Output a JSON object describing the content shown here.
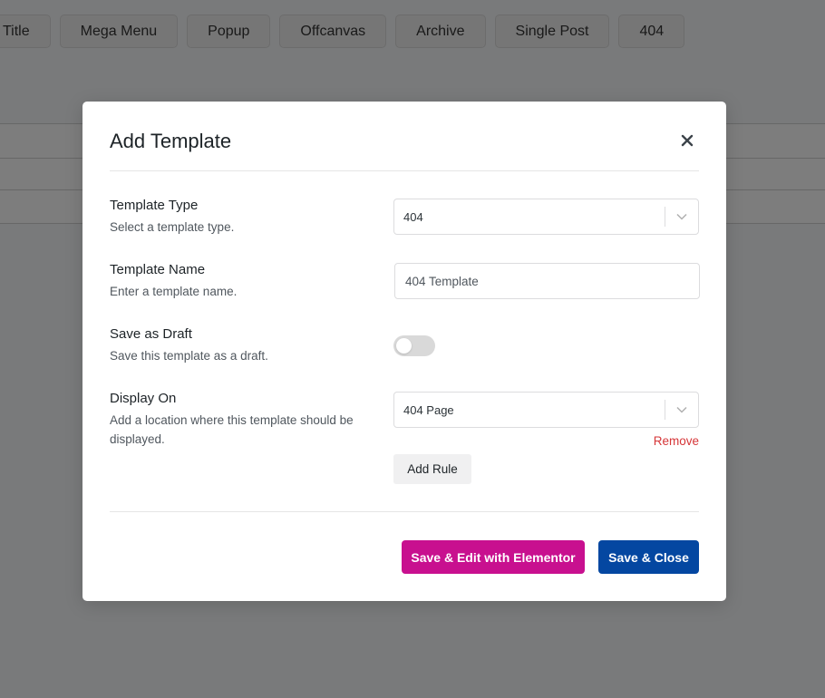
{
  "background": {
    "tabs": [
      "Title",
      "Mega Menu",
      "Popup",
      "Offcanvas",
      "Archive",
      "Single Post",
      "404"
    ]
  },
  "modal": {
    "title": "Add Template",
    "close_icon": "close-icon",
    "fields": {
      "template_type": {
        "label": "Template Type",
        "description": "Select a template type.",
        "value": "404"
      },
      "template_name": {
        "label": "Template Name",
        "description": "Enter a template name.",
        "value": "404 Template"
      },
      "save_as_draft": {
        "label": "Save as Draft",
        "description": "Save this template as a draft.",
        "enabled": false
      },
      "display_on": {
        "label": "Display On",
        "description": "Add a location where this template should be displayed.",
        "value": "404 Page",
        "remove_label": "Remove",
        "add_rule_label": "Add Rule"
      }
    },
    "footer": {
      "edit_elementor_label": "Save & Edit with Elementor",
      "save_close_label": "Save & Close"
    }
  },
  "colors": {
    "elementor_button": "#c8108f",
    "save_button": "#0447a1",
    "remove_link": "#d63638"
  }
}
